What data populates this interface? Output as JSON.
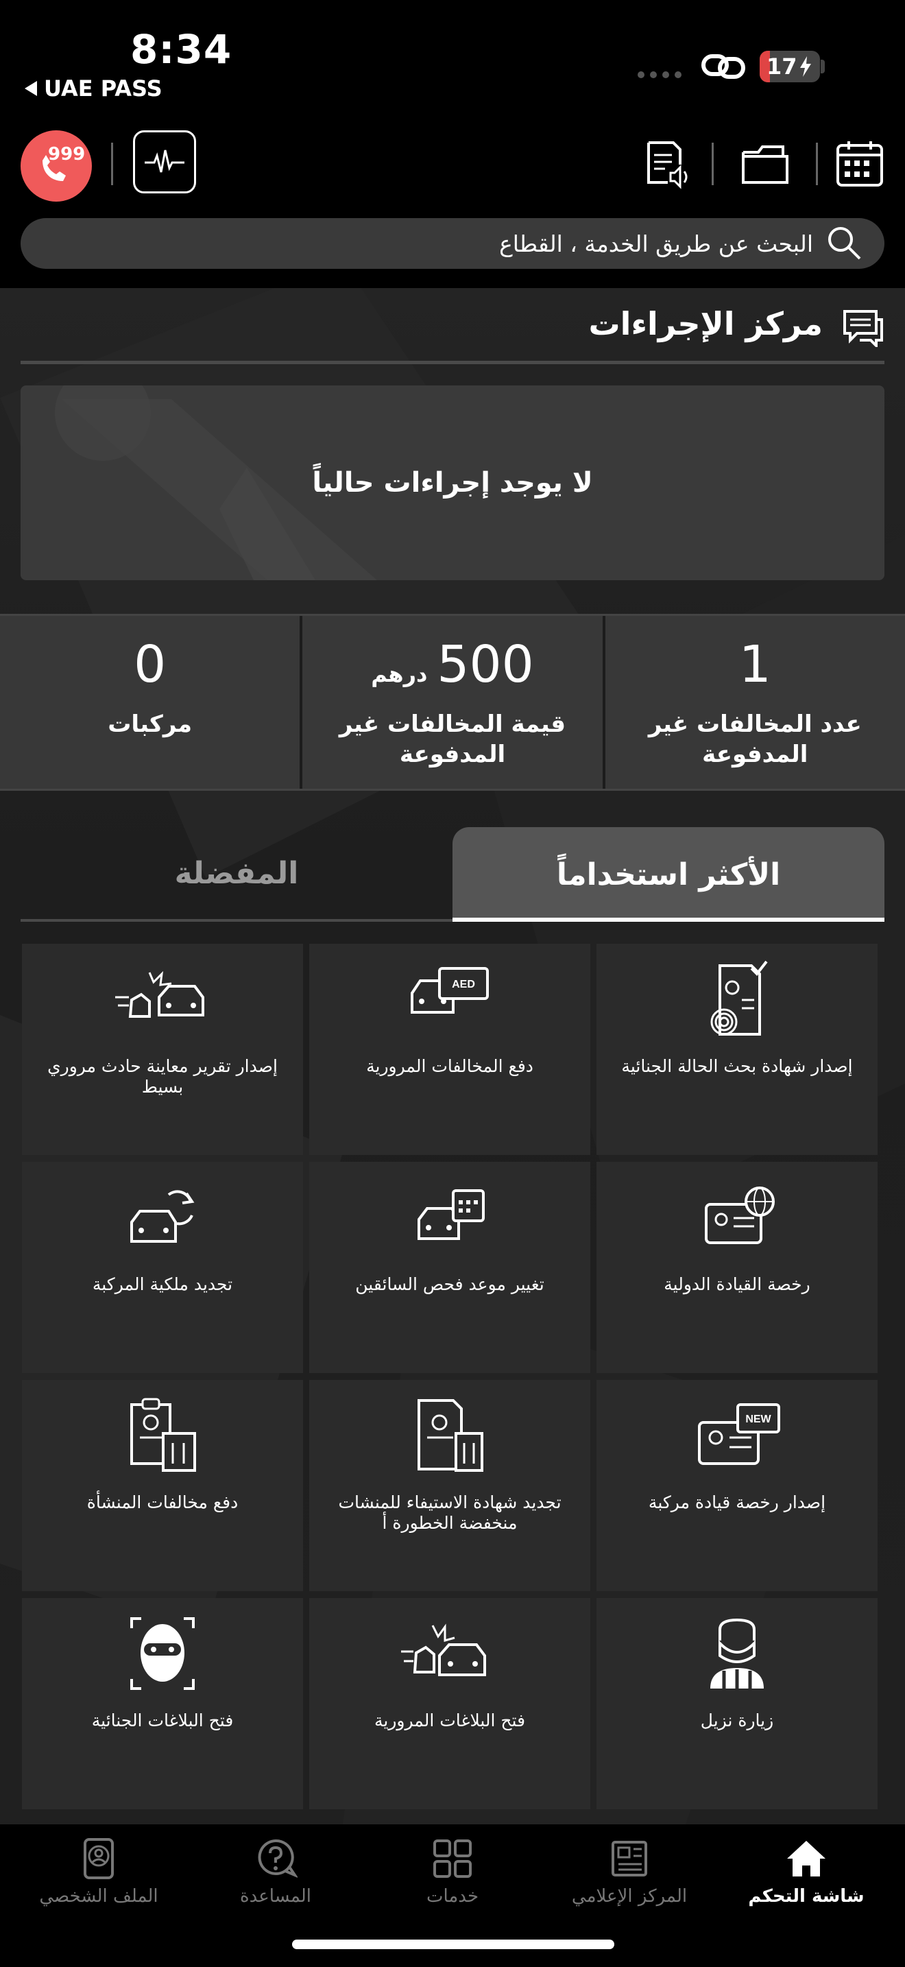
{
  "status_bar": {
    "time": "8:34",
    "back_app": "UAE PASS",
    "battery": "17",
    "battery_level": 0.17
  },
  "header": {
    "sos_number": "999",
    "search_placeholder": "البحث عن طريق الخدمة ، القطاع"
  },
  "procedures": {
    "title": "مركز الإجراءات",
    "empty_text": "لا يوجد إجراءات حالياً"
  },
  "stats": [
    {
      "value": "0",
      "unit": "",
      "label": "مركبات"
    },
    {
      "value": "500",
      "unit": "درهم",
      "label": "قيمة المخالفات غير المدفوعة"
    },
    {
      "value": "1",
      "unit": "",
      "label": "عدد المخالفات غير المدفوعة"
    }
  ],
  "tabs": {
    "active": "الأكثر استخداماً",
    "inactive": "المفضلة"
  },
  "services": [
    {
      "label": "إصدار شهادة بحث الحالة الجنائية",
      "icon": "criminal-status-certificate-icon"
    },
    {
      "label": "دفع المخالفات المرورية",
      "icon": "pay-traffic-fines-icon"
    },
    {
      "label": "إصدار تقرير معاينة حادث مروري بسيط",
      "icon": "accident-report-icon"
    },
    {
      "label": "رخصة القيادة الدولية",
      "icon": "international-license-icon"
    },
    {
      "label": "تغيير موعد فحص السائقين",
      "icon": "driver-test-appointment-icon"
    },
    {
      "label": "تجديد ملكية المركبة",
      "icon": "vehicle-renewal-icon"
    },
    {
      "label": "إصدار رخصة قيادة مركبة",
      "icon": "new-driving-license-icon"
    },
    {
      "label": "تجديد شهادة الاستيفاء للمنشات منخفضة الخطورة أ",
      "icon": "facility-certificate-icon"
    },
    {
      "label": "دفع مخالفات المنشأة",
      "icon": "facility-fines-icon"
    },
    {
      "label": "زيارة نزيل",
      "icon": "inmate-visit-icon"
    },
    {
      "label": "فتح البلاغات المرورية",
      "icon": "traffic-report-icon"
    },
    {
      "label": "فتح البلاغات الجنائية",
      "icon": "criminal-report-icon"
    }
  ],
  "nav": [
    {
      "label": "شاشة التحكم",
      "icon": "home-icon",
      "active": true
    },
    {
      "label": "المركز الإعلامي",
      "icon": "media-center-icon",
      "active": false
    },
    {
      "label": "خدمات",
      "icon": "services-grid-icon",
      "active": false
    },
    {
      "label": "المساعدة",
      "icon": "help-icon",
      "active": false
    },
    {
      "label": "الملف الشخصي",
      "icon": "profile-icon",
      "active": false
    }
  ]
}
